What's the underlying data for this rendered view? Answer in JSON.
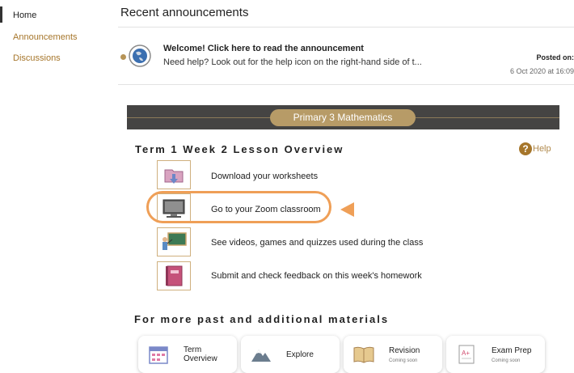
{
  "sidebar": {
    "items": [
      {
        "label": "Home"
      },
      {
        "label": "Announcements"
      },
      {
        "label": "Discussions"
      }
    ]
  },
  "announcements": {
    "heading": "Recent announcements",
    "item": {
      "title": "Welcome! Click here to read the announcement",
      "text": "Need help? Look out for the help icon on the right-hand side of t...",
      "posted_label": "Posted on:",
      "date": "6 Oct 2020 at 16:09"
    }
  },
  "course": {
    "banner": "Primary 3 Mathematics",
    "lesson_title": "Term 1 Week 2 Lesson Overview",
    "help_label": "Help",
    "items": [
      {
        "label": "Download your worksheets",
        "icon": "folder-download-icon"
      },
      {
        "label": "Go to your Zoom classroom",
        "icon": "computer-icon"
      },
      {
        "label": "See videos, games and quizzes used during the class",
        "icon": "teacher-board-icon"
      },
      {
        "label": "Submit and check feedback on this week's homework",
        "icon": "notebook-icon"
      }
    ]
  },
  "materials": {
    "title": "For more past and additional materials",
    "cards": [
      {
        "label": "Term Overview",
        "sub": "",
        "icon": "calendar-icon"
      },
      {
        "label": "Explore",
        "sub": "",
        "icon": "mountain-icon"
      },
      {
        "label": "Revision",
        "sub": "Coming soon",
        "icon": "book-icon"
      },
      {
        "label": "Exam Prep",
        "sub": "Coming soon",
        "icon": "exam-paper-icon"
      }
    ]
  },
  "colors": {
    "accent": "#a6762b",
    "banner_bg": "#454443",
    "banner_pill": "#b79b67",
    "highlight": "#ef9f57"
  }
}
